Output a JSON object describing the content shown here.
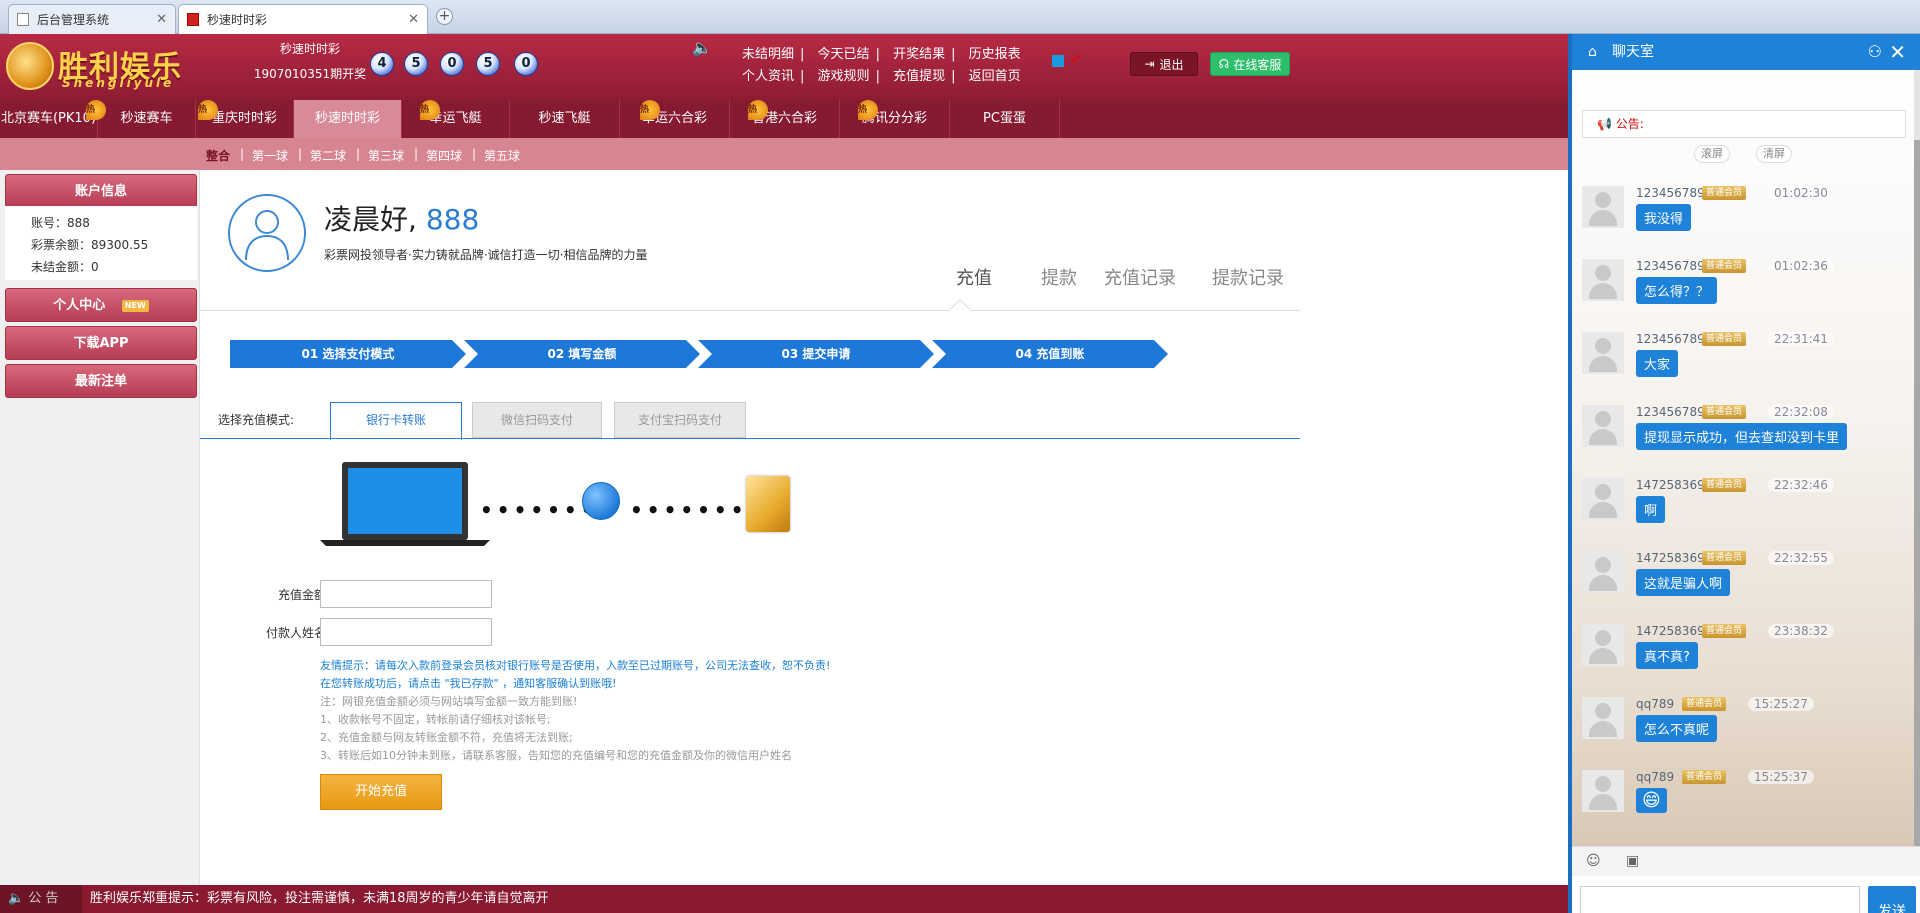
{
  "browser": {
    "tabs": [
      {
        "title": "后台管理系统",
        "active": false
      },
      {
        "title": "秒速时时彩",
        "active": true
      }
    ]
  },
  "header": {
    "brand": "胜利娱乐",
    "brand_pinyin": "Shengliyule",
    "lottery_name": "秒速时时彩",
    "period": "1907010351期开奖",
    "balls": [
      "4",
      "5",
      "0",
      "5",
      "0"
    ],
    "links_row1": [
      "未结明细",
      "今天已结",
      "开奖结果",
      "历史报表"
    ],
    "links_row2": [
      "个人资讯",
      "游戏规则",
      "充值提现",
      "返回首页"
    ],
    "logout_label": "退出",
    "service_label": "在线客服"
  },
  "nav": {
    "items": [
      {
        "label": "北京赛车(PK10)",
        "hot": true
      },
      {
        "label": "秒速赛车",
        "hot": true
      },
      {
        "label": "重庆时时彩",
        "hot": false
      },
      {
        "label": "秒速时时彩",
        "hot": true,
        "active": true
      },
      {
        "label": "幸运飞艇",
        "hot": false
      },
      {
        "label": "秒速飞艇",
        "hot": true
      },
      {
        "label": "幸运六合彩",
        "hot": true
      },
      {
        "label": "香港六合彩",
        "hot": true
      },
      {
        "label": "腾讯分分彩",
        "hot": false
      },
      {
        "label": "PC蛋蛋",
        "hot": false
      }
    ],
    "hot_label": "热",
    "sub_items": [
      "整合",
      "第一球",
      "第二球",
      "第三球",
      "第四球",
      "第五球"
    ]
  },
  "sidebar": {
    "account_title": "账户信息",
    "account_no_label": "账号：",
    "account_no": "888",
    "balance_label": "彩票余额：",
    "balance": "89300.55",
    "unsettled_label": "未结金额：",
    "unsettled": "0",
    "personal": "个人中心",
    "new_badge": "NEW",
    "download": "下载APP",
    "latest": "最新注单"
  },
  "main": {
    "greeting": "凌晨好,",
    "username": "888",
    "slogan": "彩票网投领导者·实力铸就品牌·诚信打造一切·相信品牌的力量",
    "tabs": [
      "充值",
      "提款",
      "充值记录",
      "提款记录"
    ],
    "steps": [
      "01 选择支付模式",
      "02 填写金额",
      "03 提交申请",
      "04 充值到账"
    ],
    "mode_label": "选择充值模式:",
    "modes": [
      "银行卡转账",
      "微信扫码支付",
      "支付宝扫码支付"
    ],
    "dots": "••••••••",
    "amount_label": "充值金额:",
    "payer_label": "付款人姓名:",
    "notes_blue": [
      "友情提示：请每次入款前登录会员核对银行账号是否使用，入款至已过期账号，公司无法查收，恕不负责!",
      "在您转账成功后，请点击 \"我已存款\" ，通知客服确认到账哦!"
    ],
    "notes_gray": [
      "注：网银充值金额必须与网站填写金额一致方能到账!",
      "1、收款帐号不固定，转帐前请仔细核对该帐号;",
      "2、充值金额与网友转账金额不符，充值将无法到账;",
      "3、转账后如10分钟未到账，请联系客服，告知您的充值编号和您的充值金额及你的微信用户姓名"
    ],
    "start_button": "开始充值"
  },
  "bottom": {
    "announce": "公 告",
    "message": "胜利娱乐郑重提示：彩票有风险，投注需谨慎，未满18周岁的青少年请自觉离开"
  },
  "chat": {
    "title": "聊天室",
    "notice": "公告:",
    "scroll_lock": "滚屏",
    "clear": "清屏",
    "vip": "普通会员",
    "messages": [
      {
        "name": "123456789",
        "time": "01:02:30",
        "text": "我没得"
      },
      {
        "name": "123456789",
        "time": "01:02:36",
        "text": "怎么得？？"
      },
      {
        "name": "123456789",
        "time": "22:31:41",
        "text": "大家"
      },
      {
        "name": "123456789",
        "time": "22:32:08",
        "text": "提现显示成功，但去查却没到卡里"
      },
      {
        "name": "147258369",
        "time": "22:32:46",
        "text": "啊"
      },
      {
        "name": "147258369",
        "time": "22:32:55",
        "text": "这就是骗人啊"
      },
      {
        "name": "147258369",
        "time": "23:38:32",
        "text": "真不真?"
      },
      {
        "name": "qq789",
        "time": "15:25:27",
        "text": "怎么不真呢"
      },
      {
        "name": "qq789",
        "time": "15:25:37",
        "text": "😄"
      }
    ],
    "send_label": "发送"
  }
}
